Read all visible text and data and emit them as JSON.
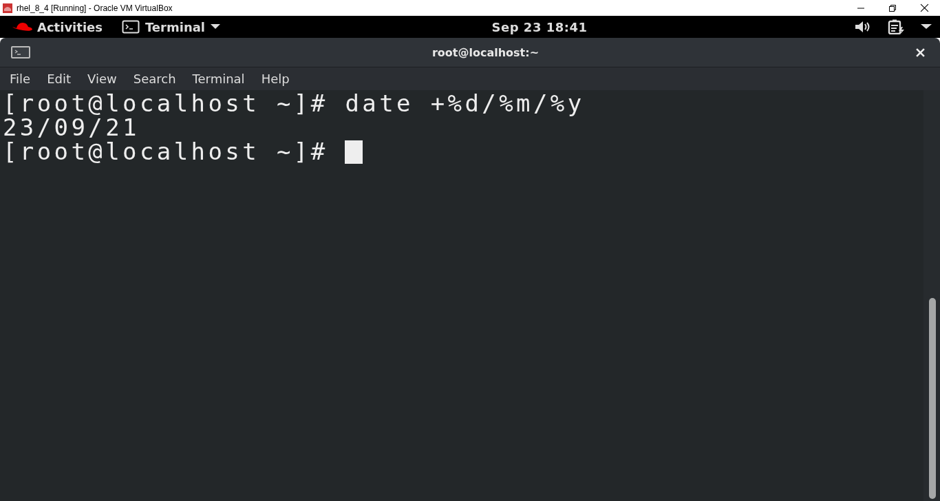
{
  "host_window": {
    "title": "rhel_8_4 [Running] - Oracle VM VirtualBox"
  },
  "top_bar": {
    "activities": "Activities",
    "app_menu": "Terminal",
    "clock": "Sep 23  18:41"
  },
  "terminal_window": {
    "title": "root@localhost:~"
  },
  "menu": [
    "File",
    "Edit",
    "View",
    "Search",
    "Terminal",
    "Help"
  ],
  "lines": [
    {
      "text": "[root@localhost ~]# date +%d/%m/%y",
      "cursor": false
    },
    {
      "text": "23/09/21",
      "cursor": false
    },
    {
      "text": "[root@localhost ~]# ",
      "cursor": true
    }
  ]
}
